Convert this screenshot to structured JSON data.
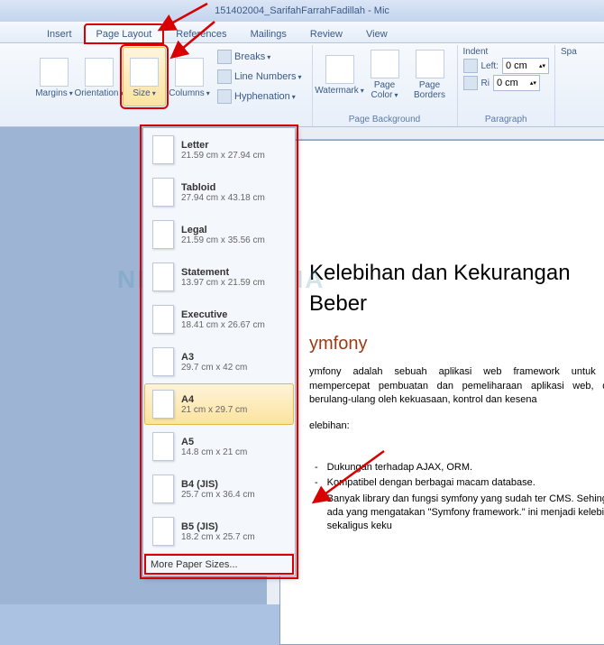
{
  "title": "151402004_SarifahFarrahFadillah - Mic",
  "tabs": [
    "Insert",
    "Page Layout",
    "References",
    "Mailings",
    "Review",
    "View"
  ],
  "activeTab": 1,
  "ribbon": {
    "pageSetup": {
      "margins": "Margins",
      "orientation": "Orientation",
      "size": "Size",
      "columns": "Columns",
      "breaks": "Breaks",
      "lineNumbers": "Line Numbers",
      "hyphenation": "Hyphenation"
    },
    "pageBackground": {
      "label": "Page Background",
      "watermark": "Watermark",
      "pageColor": "Page\nColor",
      "pageBorders": "Page\nBorders"
    },
    "paragraph": {
      "label": "Paragraph",
      "indentLabel": "Indent",
      "leftLabel": "Left:",
      "rightLabel": "Ri",
      "leftVal": "0 cm",
      "rightVal": "0 cm",
      "spacingLabel": "Spa"
    }
  },
  "sizeMenu": {
    "items": [
      {
        "name": "Letter",
        "dim": "21.59 cm x 27.94 cm"
      },
      {
        "name": "Tabloid",
        "dim": "27.94 cm x 43.18 cm"
      },
      {
        "name": "Legal",
        "dim": "21.59 cm x 35.56 cm"
      },
      {
        "name": "Statement",
        "dim": "13.97 cm x 21.59 cm"
      },
      {
        "name": "Executive",
        "dim": "18.41 cm x 26.67 cm"
      },
      {
        "name": "A3",
        "dim": "29.7 cm x 42 cm"
      },
      {
        "name": "A4",
        "dim": "21 cm x 29.7 cm"
      },
      {
        "name": "A5",
        "dim": "14.8 cm x 21 cm"
      },
      {
        "name": "B4 (JIS)",
        "dim": "25.7 cm x 36.4 cm"
      },
      {
        "name": "B5 (JIS)",
        "dim": "18.2 cm x 25.7 cm"
      }
    ],
    "selected": 6,
    "more": "More Paper Sizes..."
  },
  "doc": {
    "h1": "Kelebihan dan Kekurangan Beber",
    "h2": "ymfony",
    "p1": "ymfony adalah sebuah aplikasi web framework untuk PH mempercepat pembuatan dan pemeliharaan aplikasi web, ding berulang-ulang oleh kekuasaan, kontrol dan kesena",
    "p2": "elebihan:",
    "b1": "Dukungan terhadap AJAX, ORM.",
    "b2": "Kompatibel dengan berbagai macam database.",
    "b3": "Banyak library dan fungsi symfony yang sudah ter CMS. Sehingga ada yang mengatakan \"Symfony framework.\" ini menjadi kelebihan sekaligus keku"
  },
  "watermark": "NESABAMEDIA"
}
